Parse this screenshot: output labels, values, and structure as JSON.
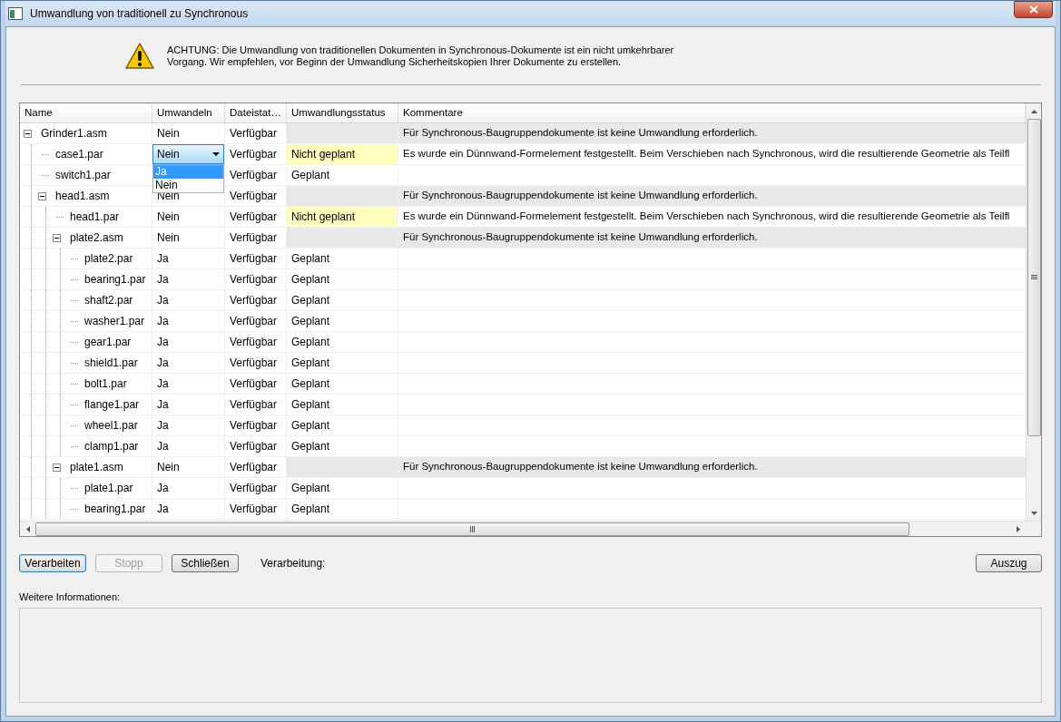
{
  "window": {
    "title": "Umwandlung von traditionell zu Synchronous"
  },
  "warning": {
    "lines": [
      "ACHTUNG: Die Umwandlung von traditionellen Dokumenten in Synchronous-Dokumente ist ein nicht umkehrbarer",
      "Vorgang. Wir empfehlen, vor Beginn der Umwandlung Sicherheitskopien Ihrer Dokumente zu erstellen."
    ]
  },
  "table": {
    "columns": [
      "Name",
      "Umwandeln",
      "Dateistat…",
      "Umwandlungsstatus",
      "Kommentare"
    ],
    "rows": [
      {
        "kind": "asm",
        "name": "Grinder1.asm",
        "expanded": true,
        "convert": "Nein",
        "file_status": "Verfügbar",
        "comment": "Für Synchronous-Baugruppendokumente ist keine Umwandlung erforderlich.",
        "children": [
          {
            "kind": "par",
            "name": "case1.par",
            "convert_dropdown": {
              "value": "Nein",
              "open": true,
              "options": [
                {
                  "label": "Ja",
                  "highlighted": true
                },
                {
                  "label": "Nein",
                  "highlighted": false
                }
              ]
            },
            "file_status": "Verfügbar",
            "status": "Nicht geplant",
            "warning": true,
            "comment": "Es wurde ein Dünnwand-Formelement festgestellt. Beim Verschieben nach Synchronous, wird die resultierende Geometrie als Teilfl"
          },
          {
            "kind": "par",
            "name": "switch1.par",
            "file_status": "Verfügbar",
            "status": "Geplant",
            "warning": false
          },
          {
            "kind": "asm",
            "name": "head1.asm",
            "expanded": true,
            "convert": "Nein",
            "file_status": "Verfügbar",
            "comment": "Für Synchronous-Baugruppendokumente ist keine Umwandlung erforderlich.",
            "children": [
              {
                "kind": "par",
                "name": "head1.par",
                "convert": "Nein",
                "file_status": "Verfügbar",
                "status": "Nicht geplant",
                "warning": true,
                "comment": "Es wurde ein Dünnwand-Formelement festgestellt. Beim Verschieben nach Synchronous, wird die resultierende Geometrie als Teilfl"
              },
              {
                "kind": "asm",
                "name": "plate2.asm",
                "expanded": true,
                "convert": "Nein",
                "file_status": "Verfügbar",
                "comment": "Für Synchronous-Baugruppendokumente ist keine Umwandlung erforderlich.",
                "children": [
                  {
                    "kind": "par",
                    "name": "plate2.par",
                    "convert": "Ja",
                    "file_status": "Verfügbar",
                    "status": "Geplant",
                    "warning": false
                  },
                  {
                    "kind": "par",
                    "name": "bearing1.par",
                    "convert": "Ja",
                    "file_status": "Verfügbar",
                    "status": "Geplant",
                    "warning": false
                  },
                  {
                    "kind": "par",
                    "name": "shaft2.par",
                    "convert": "Ja",
                    "file_status": "Verfügbar",
                    "status": "Geplant",
                    "warning": false
                  },
                  {
                    "kind": "par",
                    "name": "washer1.par",
                    "convert": "Ja",
                    "file_status": "Verfügbar",
                    "status": "Geplant",
                    "warning": false
                  },
                  {
                    "kind": "par",
                    "name": "gear1.par",
                    "convert": "Ja",
                    "file_status": "Verfügbar",
                    "status": "Geplant",
                    "warning": false
                  },
                  {
                    "kind": "par",
                    "name": "shield1.par",
                    "convert": "Ja",
                    "file_status": "Verfügbar",
                    "status": "Geplant",
                    "warning": false
                  },
                  {
                    "kind": "par",
                    "name": "bolt1.par",
                    "convert": "Ja",
                    "file_status": "Verfügbar",
                    "status": "Geplant",
                    "warning": false
                  },
                  {
                    "kind": "par",
                    "name": "flange1.par",
                    "convert": "Ja",
                    "file_status": "Verfügbar",
                    "status": "Geplant",
                    "warning": false
                  },
                  {
                    "kind": "par",
                    "name": "wheel1.par",
                    "convert": "Ja",
                    "file_status": "Verfügbar",
                    "status": "Geplant",
                    "warning": false
                  },
                  {
                    "kind": "par",
                    "name": "clamp1.par",
                    "convert": "Ja",
                    "file_status": "Verfügbar",
                    "status": "Geplant",
                    "warning": false
                  }
                ]
              },
              {
                "kind": "asm",
                "name": "plate1.asm",
                "expanded": true,
                "convert": "Nein",
                "file_status": "Verfügbar",
                "comment": "Für Synchronous-Baugruppendokumente ist keine Umwandlung erforderlich.",
                "children": [
                  {
                    "kind": "par",
                    "name": "plate1.par",
                    "convert": "Ja",
                    "file_status": "Verfügbar",
                    "status": "Geplant",
                    "warning": false
                  },
                  {
                    "kind": "par",
                    "name": "bearing1.par",
                    "convert": "Ja",
                    "file_status": "Verfügbar",
                    "status": "Geplant",
                    "warning": false
                  }
                ]
              }
            ]
          }
        ]
      }
    ]
  },
  "buttons": [
    {
      "label": "Verarbeiten",
      "disabled": false,
      "default": true
    },
    {
      "label": "Stopp",
      "disabled": true,
      "default": false
    },
    {
      "label": "Schließen",
      "disabled": false,
      "default": false
    }
  ],
  "progress_label": "Verarbeitung:",
  "extract_button": {
    "label": "Auszug"
  },
  "info": {
    "label": "Weitere Informationen:"
  }
}
